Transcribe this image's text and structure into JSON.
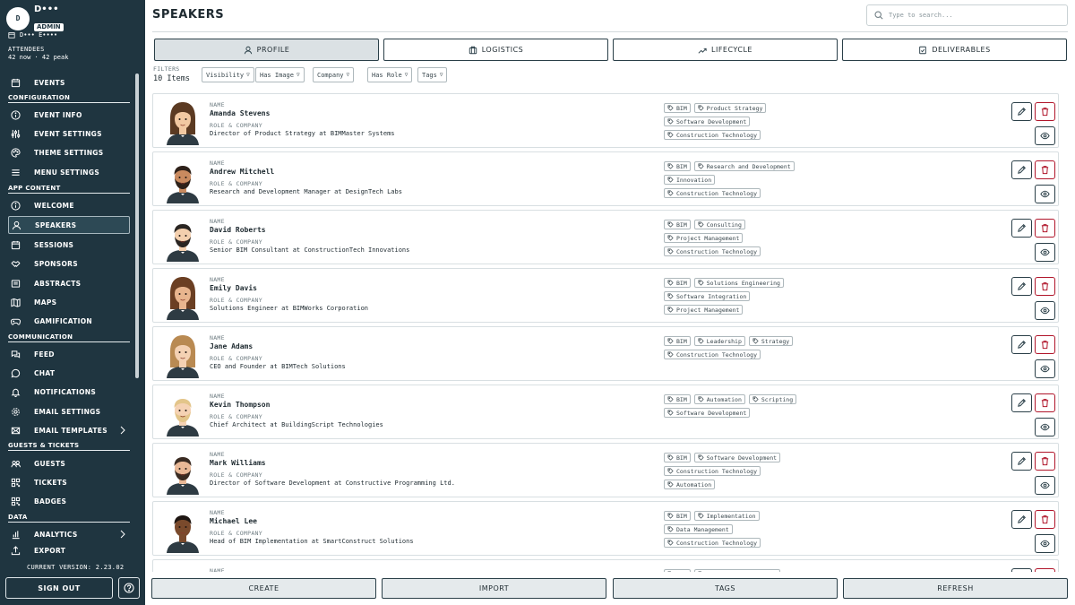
{
  "user": {
    "initial": "D",
    "name": "D•••",
    "role": "ADMIN"
  },
  "event": {
    "name": "D••• E••••"
  },
  "attendees": {
    "label": "ATTENDEES",
    "value": "42 now · 42 peak"
  },
  "nav": {
    "events": "EVENTS",
    "configuration": "CONFIGURATION",
    "event_info": "EVENT INFO",
    "event_settings": "EVENT SETTINGS",
    "theme_settings": "THEME SETTINGS",
    "menu_settings": "MENU SETTINGS",
    "app_content": "APP CONTENT",
    "welcome": "WELCOME",
    "speakers": "SPEAKERS",
    "sessions": "SESSIONS",
    "sponsors": "SPONSORS",
    "abstracts": "ABSTRACTS",
    "maps": "MAPS",
    "gamification": "GAMIFICATION",
    "communication": "COMMUNICATION",
    "feed": "FEED",
    "chat": "CHAT",
    "notifications": "NOTIFICATIONS",
    "email_settings": "EMAIL SETTINGS",
    "email_templates": "EMAIL TEMPLATES",
    "guests_tickets": "GUESTS & TICKETS",
    "guests": "GUESTS",
    "tickets": "TICKETS",
    "badges": "BADGES",
    "data": "DATA",
    "analytics": "ANALYTICS",
    "export": "EXPORT"
  },
  "version": "CURRENT VERSION: 2.23.02",
  "signout": "SIGN OUT",
  "page": {
    "title": "SPEAKERS"
  },
  "search": {
    "placeholder": "Type to search..."
  },
  "tabs": {
    "profile": "PROFILE",
    "logistics": "LOGISTICS",
    "lifecycle": "LIFECYCLE",
    "deliverables": "DELIVERABLES"
  },
  "filters": {
    "label": "FILTERS",
    "count": "10 Items",
    "visibility": "Visibility",
    "has_image": "Has Image",
    "company": "Company",
    "has_role": "Has Role",
    "tags": "Tags"
  },
  "labels": {
    "name": "NAME",
    "role": "ROLE & COMPANY"
  },
  "speakers": [
    {
      "name": "Amanda Stevens",
      "role": "Director of Product Strategy at BIMMaster Systems",
      "tags": [
        [
          "BIM",
          "Product Strategy"
        ],
        [
          "Software Development"
        ],
        [
          "Construction Technology"
        ]
      ]
    },
    {
      "name": "Andrew Mitchell",
      "role": "Research and Development Manager at DesignTech Labs",
      "tags": [
        [
          "BIM",
          "Research and Development"
        ],
        [
          "Innovation"
        ],
        [
          "Construction Technology"
        ]
      ]
    },
    {
      "name": "David Roberts",
      "role": "Senior BIM Consultant at ConstructionTech Innovations",
      "tags": [
        [
          "BIM",
          "Consulting"
        ],
        [
          "Project Management"
        ],
        [
          "Construction Technology"
        ]
      ]
    },
    {
      "name": "Emily Davis",
      "role": "Solutions Engineer at BIMWorks Corporation",
      "tags": [
        [
          "BIM",
          "Solutions Engineering"
        ],
        [
          "Software Integration"
        ],
        [
          "Project Management"
        ]
      ]
    },
    {
      "name": "Jane Adams",
      "role": "CEO and Founder at BIMTech Solutions",
      "tags": [
        [
          "BIM",
          "Leadership",
          "Strategy"
        ],
        [
          "Construction Technology"
        ]
      ]
    },
    {
      "name": "Kevin Thompson",
      "role": "Chief Architect at BuildingScript Technologies",
      "tags": [
        [
          "BIM",
          "Automation",
          "Scripting"
        ],
        [
          "Software Development"
        ]
      ]
    },
    {
      "name": "Mark Williams",
      "role": "Director of Software Development at Constructive Programming Ltd.",
      "tags": [
        [
          "BIM",
          "Software Development"
        ],
        [
          "Construction Technology"
        ],
        [
          "Automation"
        ]
      ]
    },
    {
      "name": "Michael Lee",
      "role": "Head of BIM Implementation at SmartConstruct Solutions",
      "tags": [
        [
          "BIM",
          "Implementation"
        ],
        [
          "Data Management"
        ],
        [
          "Construction Technology"
        ]
      ]
    },
    {
      "name": "",
      "role": "",
      "tags": [
        [
          "BIM",
          "Software Engineering"
        ]
      ]
    }
  ],
  "footer": {
    "create": "CREATE",
    "import": "IMPORT",
    "tags": "TAGS",
    "refresh": "REFRESH"
  },
  "colors": {
    "sidebar": "#1f3540",
    "accent": "#2a3f48",
    "danger": "#b0152a"
  }
}
